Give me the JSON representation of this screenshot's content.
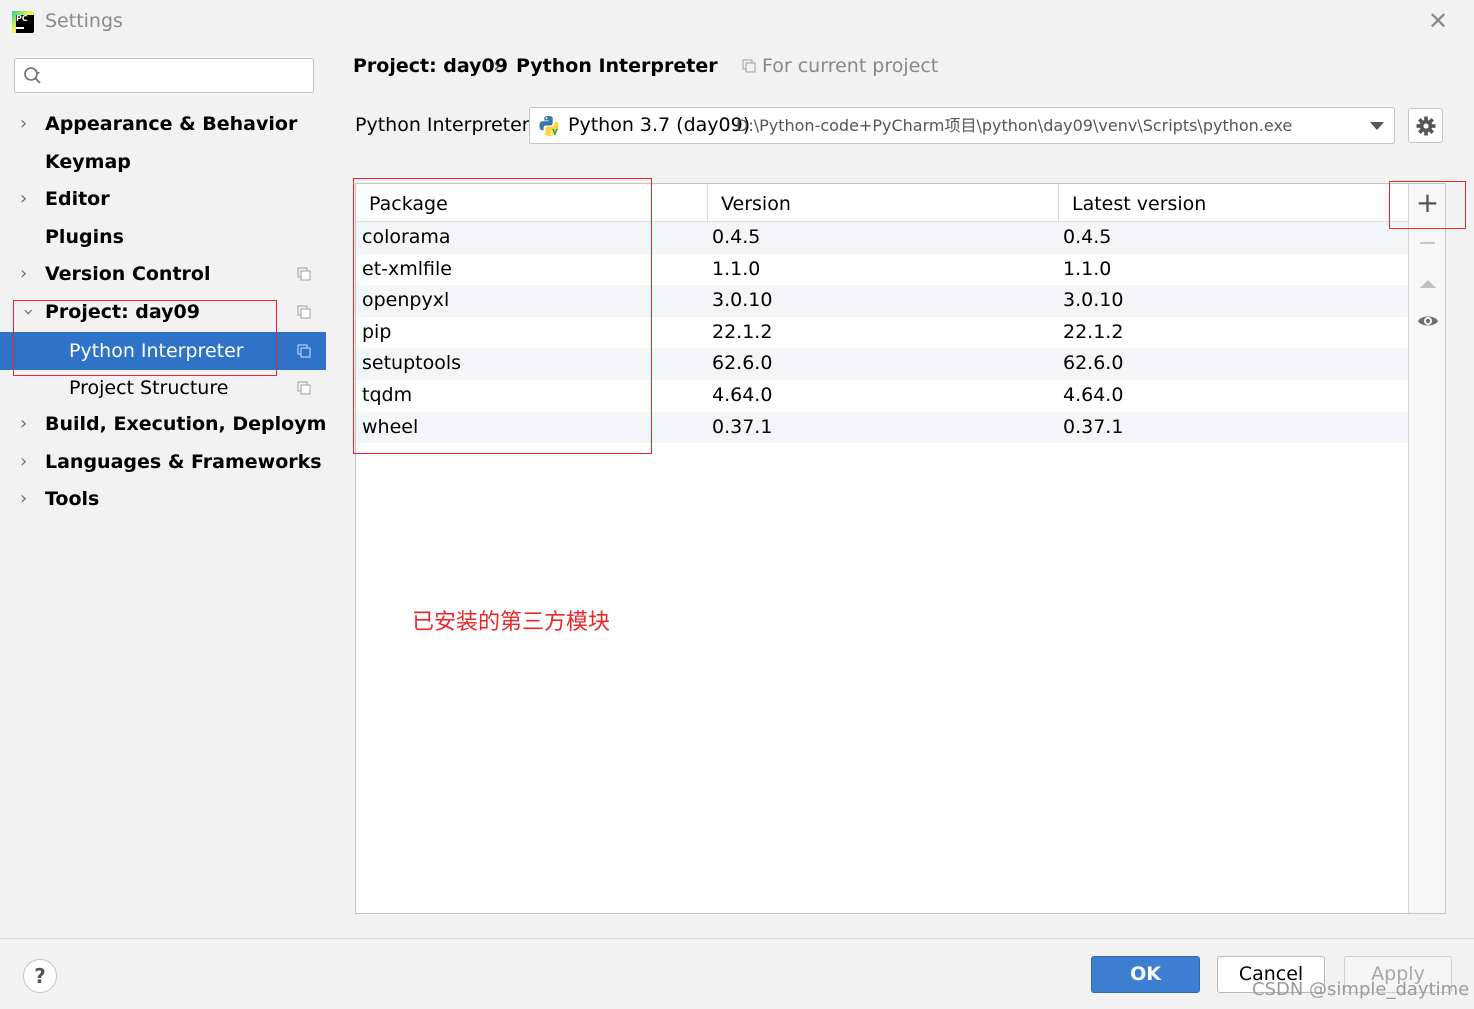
{
  "window": {
    "title": "Settings"
  },
  "sidebar": {
    "search": {
      "value": "",
      "placeholder": ""
    },
    "items": [
      {
        "label": "Appearance & Behavior",
        "expandable": true
      },
      {
        "label": "Keymap",
        "expandable": false
      },
      {
        "label": "Editor",
        "expandable": true
      },
      {
        "label": "Plugins",
        "expandable": false
      },
      {
        "label": "Version Control",
        "expandable": true
      },
      {
        "label": "Project: day09",
        "expandable": true,
        "expanded": true
      },
      {
        "label": "Python Interpreter",
        "selected": true
      },
      {
        "label": "Project Structure"
      },
      {
        "label": "Build, Execution, Deployment",
        "expandable": true
      },
      {
        "label": "Languages & Frameworks",
        "expandable": true
      },
      {
        "label": "Tools",
        "expandable": true
      }
    ]
  },
  "header": {
    "project": "Project: day09",
    "separator": "›",
    "page": "Python Interpreter",
    "scope": "For current project"
  },
  "interpreter": {
    "label": "Python Interpreter:",
    "name": "Python 3.7 (day09)",
    "path": "D:\\Python-code+PyCharm项目\\python\\day09\\venv\\Scripts\\python.exe"
  },
  "table": {
    "columns": [
      "Package",
      "Version",
      "Latest version"
    ],
    "rows": [
      [
        "colorama",
        "0.4.5",
        "0.4.5"
      ],
      [
        "et-xmlfile",
        "1.1.0",
        "1.1.0"
      ],
      [
        "openpyxl",
        "3.0.10",
        "3.0.10"
      ],
      [
        "pip",
        "22.1.2",
        "22.1.2"
      ],
      [
        "setuptools",
        "62.6.0",
        "62.6.0"
      ],
      [
        "tqdm",
        "4.64.0",
        "4.64.0"
      ],
      [
        "wheel",
        "0.37.1",
        "0.37.1"
      ]
    ]
  },
  "toolbar": {
    "add": "+"
  },
  "annotation": "已安装的第三方模块",
  "footer": {
    "help": "?",
    "ok": "OK",
    "cancel": "Cancel",
    "apply": "Apply",
    "watermark": "CSDN @simple_daytime"
  },
  "colors": {
    "selection": "#2f73c9",
    "ok_button": "#3c7fd1",
    "annotation_red": "#e8272b"
  }
}
